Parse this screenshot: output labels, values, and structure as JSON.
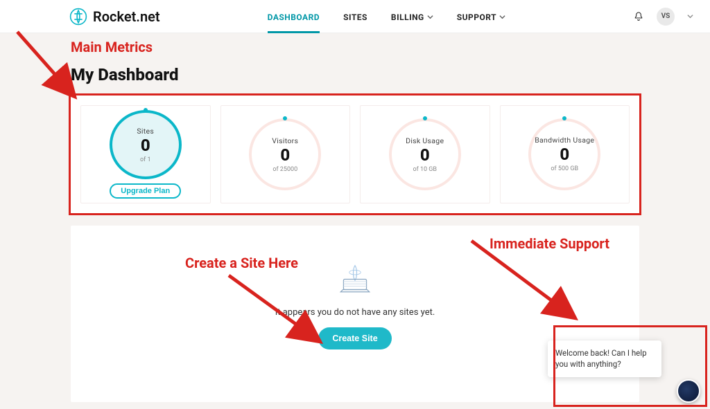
{
  "brand": {
    "name": "Rocket.net"
  },
  "nav": {
    "dashboard": "DASHBOARD",
    "sites": "SITES",
    "billing": "BILLING",
    "support": "SUPPORT"
  },
  "user": {
    "initials": "VS"
  },
  "page": {
    "title": "My Dashboard"
  },
  "metrics": [
    {
      "title": "Sites",
      "value": "0",
      "sub": "of 1",
      "upgrade": "Upgrade Plan",
      "filled": true
    },
    {
      "title": "Visitors",
      "value": "0",
      "sub": "of 25000"
    },
    {
      "title": "Disk Usage",
      "value": "0",
      "sub": "of 10 GB"
    },
    {
      "title": "Bandwidth Usage",
      "value": "0",
      "sub": "of 500 GB"
    }
  ],
  "empty": {
    "text": "It appears you do not have any sites yet.",
    "cta": "Create Site"
  },
  "chat": {
    "message": "Welcome back! Can I help you with anything?"
  },
  "annotations": {
    "main_metrics": "Main Metrics",
    "create_here": "Create a Site Here",
    "immediate_support": "Immediate Support"
  }
}
